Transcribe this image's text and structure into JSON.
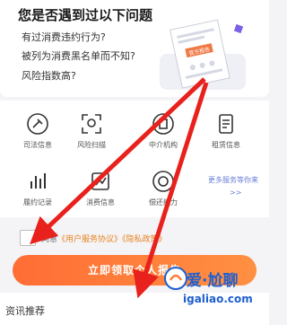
{
  "card": {
    "title": "您是否遇到过以下问题",
    "questions": [
      "有过消费违约行为?",
      "被列为消费黑名单而不知?",
      "风险指数高?"
    ],
    "doc_label": "官方报告"
  },
  "services": [
    {
      "label": "司法信息",
      "icon": "gavel-icon"
    },
    {
      "label": "风险扫描",
      "icon": "scan-icon"
    },
    {
      "label": "中介机构",
      "icon": "building-icon"
    },
    {
      "label": "租赁信息",
      "icon": "list-icon"
    },
    {
      "label": "履约记录",
      "icon": "bars-icon"
    },
    {
      "label": "消费信息",
      "icon": "chart-icon"
    },
    {
      "label": "偿还能力",
      "icon": "coin-icon"
    }
  ],
  "more": {
    "text": "更多服务等你来",
    "arrow": ">>"
  },
  "agreement": {
    "prefix": "同意",
    "doc1": "《用户服务协议》",
    "doc2": "《隐私政策》"
  },
  "cta": {
    "label": "立即领取个人报告"
  },
  "news": {
    "title": "资讯推荐"
  },
  "watermark": {
    "top": "爱·尬聊",
    "bottom": "igaliao.com"
  },
  "colors": {
    "accent": "#ff7a3c",
    "arrow": "#e8211c",
    "link": "#6b7fd7"
  }
}
